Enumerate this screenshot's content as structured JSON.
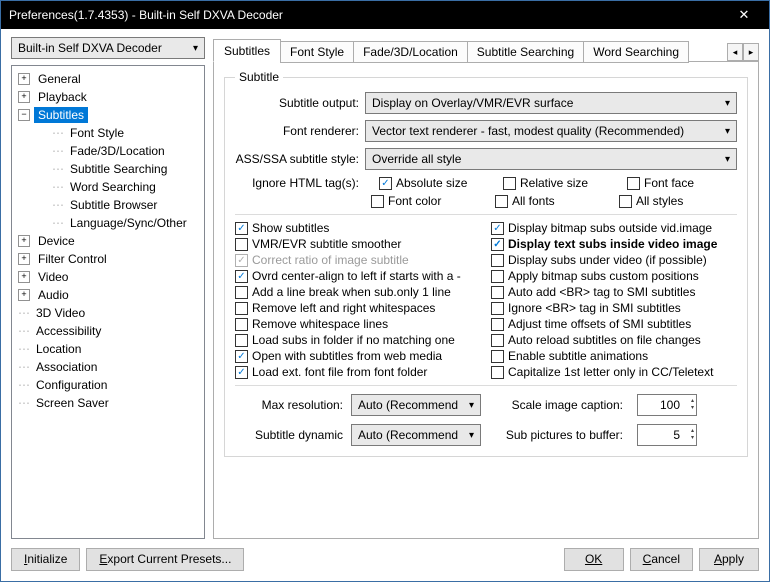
{
  "window": {
    "title": "Preferences(1.7.4353) - Built-in Self DXVA Decoder"
  },
  "left": {
    "combo_value": "Built-in Self DXVA Decoder",
    "tree": {
      "general": "General",
      "playback": "Playback",
      "subtitles": "Subtitles",
      "font_style": "Font Style",
      "fade_3d": "Fade/3D/Location",
      "sub_search": "Subtitle Searching",
      "word_search": "Word Searching",
      "sub_browser": "Subtitle Browser",
      "lang_sync": "Language/Sync/Other",
      "device": "Device",
      "filter_ctrl": "Filter Control",
      "video": "Video",
      "audio": "Audio",
      "3d_video": "3D Video",
      "accessibility": "Accessibility",
      "location": "Location",
      "association": "Association",
      "configuration": "Configuration",
      "screen_saver": "Screen Saver"
    }
  },
  "tabs": {
    "subtitles": "Subtitles",
    "font_style": "Font Style",
    "fade_3d": "Fade/3D/Location",
    "sub_search": "Subtitle Searching",
    "word_search": "Word Searching"
  },
  "fieldset": {
    "legend": "Subtitle",
    "labels": {
      "subtitle_output": "Subtitle output:",
      "font_renderer": "Font renderer:",
      "ass_ssa_style": "ASS/SSA subtitle style:",
      "ignore_html": "Ignore HTML tag(s):"
    },
    "selects": {
      "subtitle_output": "Display on Overlay/VMR/EVR surface",
      "font_renderer": "Vector text renderer - fast, modest quality (Recommended)",
      "ass_ssa_style": "Override all style"
    },
    "ignore_checks": {
      "abs_size": "Absolute size",
      "rel_size": "Relative size",
      "font_face": "Font face",
      "font_color": "Font color",
      "all_fonts": "All fonts",
      "all_styles": "All styles"
    },
    "checks_left": {
      "show_subtitles": "Show subtitles",
      "vmr_evr_smoother": "VMR/EVR subtitle smoother",
      "correct_ratio": "Correct ratio of image subtitle",
      "ovrd_center": "Ovrd center-align to left if starts with a -",
      "add_linebreak": "Add a line break when sub.only 1 line",
      "remove_lr_ws": "Remove left and right whitespaces",
      "remove_ws_lines": "Remove whitespace lines",
      "load_no_match": "Load subs in folder if no matching one",
      "open_web_media": "Open with subtitles from web media",
      "load_ext_font": "Load ext. font file from font folder"
    },
    "checks_right": {
      "display_bitmap_outside": "Display bitmap subs outside vid.image",
      "display_text_inside": "Display text subs inside video image",
      "display_under_video": "Display subs under video (if possible)",
      "apply_bitmap_custom": "Apply bitmap subs custom positions",
      "auto_add_br_smi": "Auto add <BR> tag to SMI subtitles",
      "ignore_br_smi": "Ignore <BR> tag in SMI subtitles",
      "adjust_smi_offsets": "Adjust time offsets of SMI subtitles",
      "auto_reload": "Auto reload subtitles on file changes",
      "enable_anim": "Enable subtitle animations",
      "cap_first_cc": "Capitalize 1st letter only in CC/Teletext"
    },
    "bottom": {
      "max_res_label": "Max resolution:",
      "max_res_value": "Auto (Recommend",
      "scale_caption_label": "Scale image caption:",
      "scale_caption_value": "100",
      "sub_dynamic_label": "Subtitle dynamic",
      "sub_dynamic_value": "Auto (Recommend",
      "pics_buffer_label": "Sub pictures to buffer:",
      "pics_buffer_value": "5"
    }
  },
  "footer": {
    "initialize": "Initialize",
    "export": "Export Current Presets...",
    "ok": "OK",
    "cancel": "Cancel",
    "apply": "Apply"
  }
}
